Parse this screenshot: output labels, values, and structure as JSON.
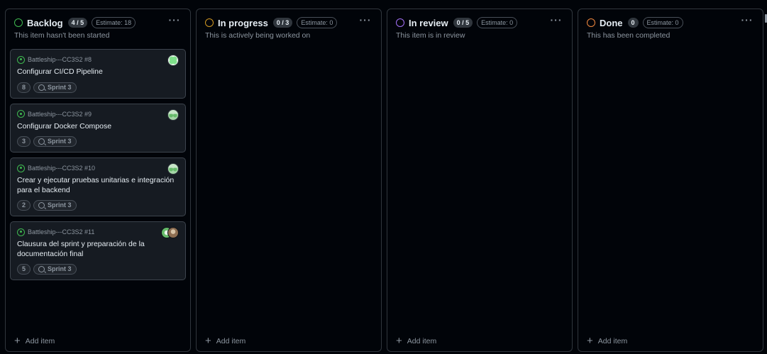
{
  "columns": [
    {
      "title": "Backlog",
      "count": "4 / 5",
      "estimate": "Estimate: 18",
      "description": "This item hasn't been started",
      "status_color": "#3fb950",
      "add_label": "Add item",
      "cards": [
        {
          "ref": "Battleship---CC3S2 #8",
          "title": "Configurar CI/CD Pipeline",
          "points": "8",
          "sprint": "Sprint 3",
          "avatar": "identicon-green"
        },
        {
          "ref": "Battleship---CC3S2 #9",
          "title": "Configurar Docker Compose",
          "points": "3",
          "sprint": "Sprint 3",
          "avatar": "identicon-light-green"
        },
        {
          "ref": "Battleship---CC3S2 #10",
          "title": "Crear y ejecutar pruebas unitarias e integración para el backend",
          "points": "2",
          "sprint": "Sprint 3",
          "avatar": "identicon-light-green"
        },
        {
          "ref": "Battleship---CC3S2 #11",
          "title": "Clausura del sprint y preparación de la documentación final",
          "points": "5",
          "sprint": "Sprint 3",
          "avatar": "two-avatars"
        }
      ]
    },
    {
      "title": "In progress",
      "count": "0 / 3",
      "estimate": "Estimate: 0",
      "description": "This is actively being worked on",
      "status_color": "#d29922",
      "add_label": "Add item",
      "cards": []
    },
    {
      "title": "In review",
      "count": "0 / 5",
      "estimate": "Estimate: 0",
      "description": "This item is in review",
      "status_color": "#a371f7",
      "add_label": "Add item",
      "cards": []
    },
    {
      "title": "Done",
      "count": "0",
      "estimate": "Estimate: 0",
      "description": "This has been completed",
      "status_color": "#f0883e",
      "add_label": "Add item",
      "cards": []
    }
  ],
  "icons": {
    "more": "more-horizontal-icon",
    "issue": "issue-open-icon",
    "sprint": "iteration-icon",
    "add": "plus-icon"
  }
}
